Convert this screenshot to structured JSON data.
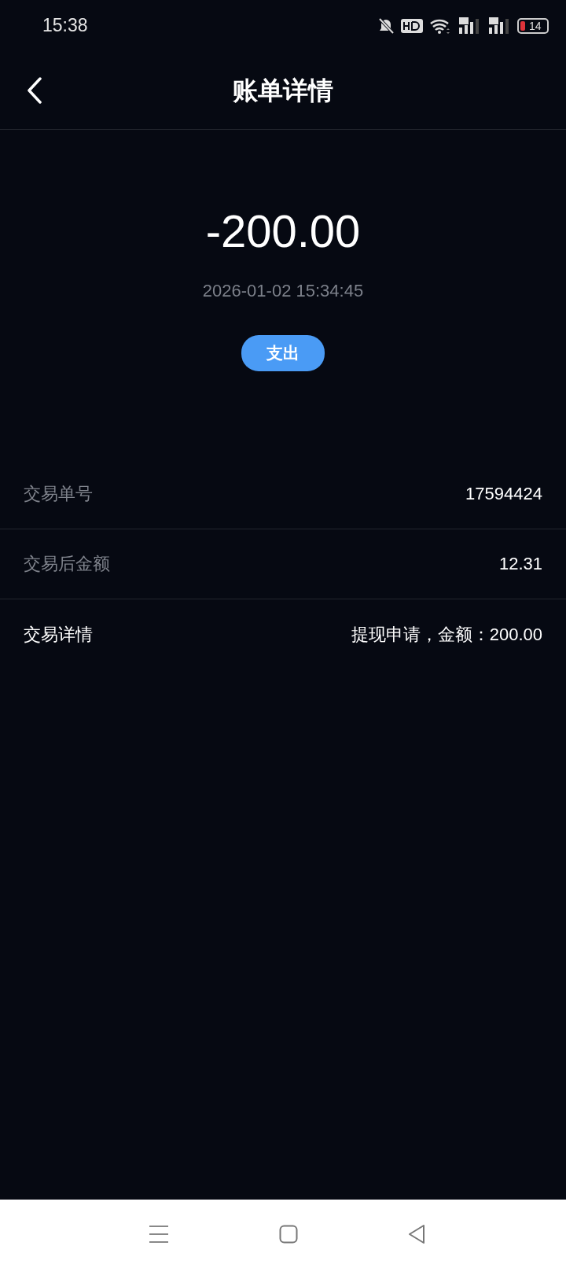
{
  "status_bar": {
    "time": "15:38",
    "battery": "14"
  },
  "header": {
    "title": "账单详情"
  },
  "summary": {
    "amount": "-200.00",
    "datetime": "2026-01-02 15:34:45",
    "type_badge": "支出"
  },
  "details": [
    {
      "label": "交易单号",
      "value": "17594424",
      "emphasized": false
    },
    {
      "label": "交易后金额",
      "value": "12.31",
      "emphasized": false
    },
    {
      "label": "交易详情",
      "value": "提现申请，金额：200.00",
      "emphasized": true
    }
  ]
}
